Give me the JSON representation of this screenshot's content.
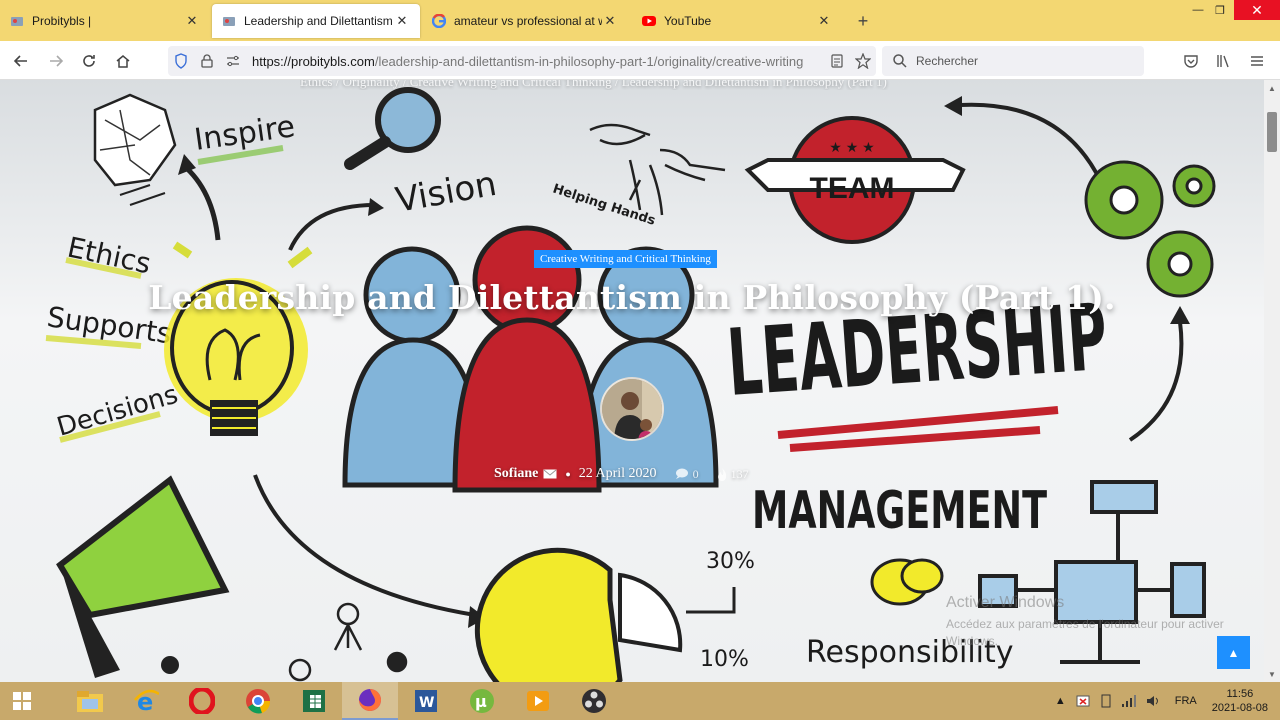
{
  "tabs": [
    {
      "title": "Probitybls |",
      "icon": "probitybls-favicon",
      "active": false
    },
    {
      "title": "Leadership and Dilettantism in P",
      "icon": "probitybls-favicon",
      "active": true
    },
    {
      "title": "amateur vs professional at work",
      "icon": "google-favicon",
      "active": false
    },
    {
      "title": "YouTube",
      "icon": "youtube-favicon",
      "active": false
    }
  ],
  "new_tab_label": "+",
  "window_controls": {
    "minimize": "—",
    "restore": "❐",
    "close": "✕"
  },
  "nav": {
    "url_domain": "https://probitybls.com",
    "url_path": "/leadership-and-dilettantism-in-philosophy-part-1/originality/creative-writing",
    "search_placeholder": "Rechercher"
  },
  "page": {
    "breadcrumb": "Ethics / Originality / Creative Writing and Critical Thinking / Leadership and Dilettantism in Philosophy (Part 1)",
    "category": "Creative Writing and Critical Thinking",
    "title": "Leadership and Dilettantism in Philosophy (Part 1).",
    "author": "Sofiane",
    "date": "22 April 2020",
    "comments": "0",
    "views": "137",
    "back_to_top": "▲"
  },
  "illustration_words": {
    "inspire": "Inspire",
    "vision": "Vision",
    "helping_hands": "Helping Hands",
    "team": "TEAM",
    "ethics": "Ethics",
    "supports": "Supports",
    "decisions": "Decisions",
    "leadership": "LEADERSHIP",
    "management": "MANAGEMENT",
    "pct30": "30%",
    "pct10": "10%",
    "responsibility": "Responsibility"
  },
  "watermark": {
    "line1": "Activer Windows",
    "line2": "Accédez aux paramètres de l'ordinateur pour activer Windows."
  },
  "taskbar": {
    "apps": [
      "file-explorer-icon",
      "internet-explorer-icon",
      "opera-icon",
      "chrome-icon",
      "excel-icon",
      "firefox-icon",
      "word-icon",
      "utorrent-icon",
      "media-player-icon",
      "obs-icon"
    ],
    "language": "FRA",
    "time": "11:56",
    "date": "2021-08-08"
  },
  "colors": {
    "tab_strip": "#f3d772",
    "accent": "#1e90ff",
    "taskbar": "#c8a96b",
    "close_red": "#e81123"
  }
}
